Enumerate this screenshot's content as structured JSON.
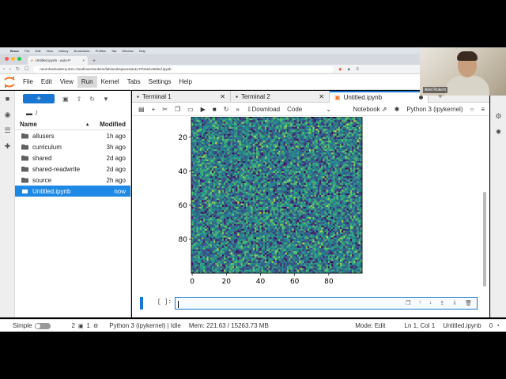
{
  "mac_menu": [
    "Brave",
    "File",
    "Edit",
    "View",
    "History",
    "Bookmarks",
    "Profiles",
    "Tab",
    "Window",
    "Help"
  ],
  "browser": {
    "tab_title": "Untitled.ipynb - auto-P",
    "url": "neurohackademy.2i2c.cloud/user/arokem/lab/workspaces/auto-P/tree/Untitled.ipynb"
  },
  "jupyter_menu": [
    "File",
    "Edit",
    "View",
    "Run",
    "Kernel",
    "Tabs",
    "Settings",
    "Help"
  ],
  "file_browser": {
    "new_label": "+",
    "path": "/",
    "columns": {
      "name": "Name",
      "modified": "Modified"
    },
    "files": [
      {
        "name": "allusers",
        "modified": "1h ago",
        "type": "folder"
      },
      {
        "name": "curriculum",
        "modified": "3h ago",
        "type": "folder"
      },
      {
        "name": "shared",
        "modified": "2d ago",
        "type": "folder"
      },
      {
        "name": "shared-readwrite",
        "modified": "2d ago",
        "type": "folder"
      },
      {
        "name": "source",
        "modified": "2h ago",
        "type": "folder"
      },
      {
        "name": "Untitled.ipynb",
        "modified": "now",
        "type": "notebook",
        "selected": true
      }
    ]
  },
  "doc_tabs": [
    {
      "label": "Terminal 1",
      "active": false
    },
    {
      "label": "Terminal 2",
      "active": false
    },
    {
      "label": "Untitled.ipynb",
      "active": true
    }
  ],
  "notebook_toolbar": {
    "download": "Download",
    "cell_type": "Code",
    "notebook_label": "Notebook",
    "kernel": "Python 3 (ipykernel)"
  },
  "plot": {
    "y_ticks": [
      "20",
      "40",
      "60",
      "80"
    ],
    "x_ticks": [
      "0",
      "20",
      "40",
      "60",
      "80"
    ],
    "colormap": [
      "#440154",
      "#3b528b",
      "#21918c",
      "#5ec962",
      "#fde725"
    ]
  },
  "input_cell": {
    "prompt": "[ ]:",
    "content": ""
  },
  "status_bar": {
    "mode_label": "Simple",
    "terminals": "2",
    "kernels": "1",
    "kernel_status": "Python 3 (ipykernel) | Idle",
    "memory": "Mem: 221.63 / 15263.73 MB",
    "edit_mode": "Mode: Edit",
    "cursor": "Ln 1, Col 1",
    "filename": "Untitled.ipynb",
    "notifications": "0"
  },
  "webcam": {
    "name": "Ariel Rokem"
  }
}
